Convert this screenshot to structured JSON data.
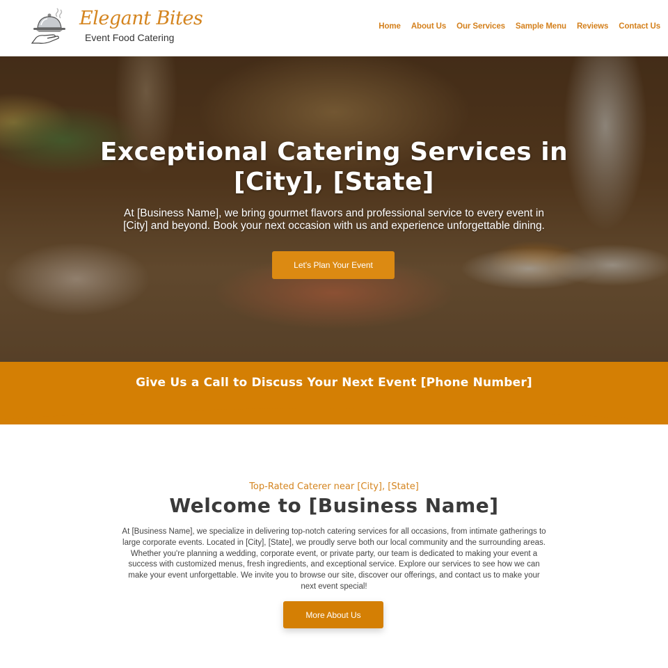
{
  "brand": {
    "name": "Elegant Bites",
    "tagline": "Event Food Catering",
    "accent_color": "#d4801c",
    "button_color": "#d47f04"
  },
  "nav": {
    "items": [
      {
        "label": "Home"
      },
      {
        "label": "About Us"
      },
      {
        "label": "Our Services"
      },
      {
        "label": "Sample Menu"
      },
      {
        "label": "Reviews"
      },
      {
        "label": "Contact Us"
      }
    ]
  },
  "hero": {
    "title_line1": "Exceptional Catering Services in",
    "title_line2": "[City], [State]",
    "text": "At [Business Name], we bring gourmet flavors and professional service to every event in [City] and beyond. Book your next occasion with us and experience unforgettable dining.",
    "cta_label": "Let's Plan Your Event",
    "image_description": "catering-buffet-table"
  },
  "call_band": {
    "text": "Give Us a Call to Discuss Your Next Event [Phone Number]"
  },
  "welcome": {
    "kicker": "Top-Rated Caterer near  [City], [State]",
    "title": "Welcome to [Business Name]",
    "text": "At [Business Name], we specialize in delivering top-notch catering services for all occasions, from intimate gatherings to large corporate events. Located in [City], [State], we proudly serve both our local community and the surrounding areas. Whether you're planning a wedding, corporate event, or private party, our team is dedicated to making your event a success with customized menus, fresh ingredients, and exceptional service. Explore our services to see how we can make your event unforgettable. We invite you to browse our site, discover our offerings, and contact us to make your next event special!",
    "button_label": "More About Us"
  }
}
